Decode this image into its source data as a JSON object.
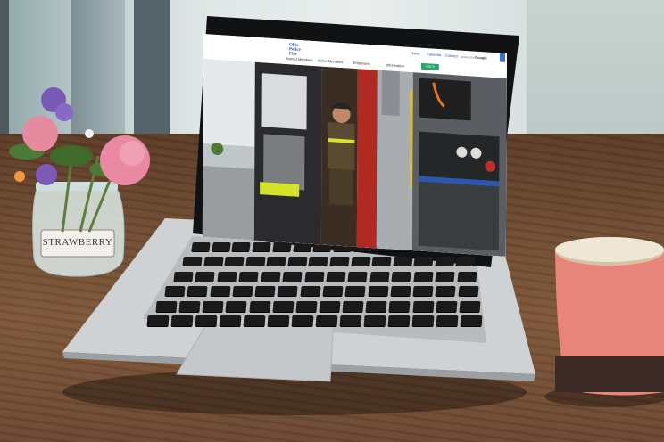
{
  "website": {
    "logo": {
      "line1": "Ohio",
      "line2": "Police",
      "line3": "Fire"
    },
    "top_links": [
      "Home",
      "Calendar",
      "Contact"
    ],
    "translate_label": "powered by",
    "translate_brand": "Google",
    "main_nav": [
      "Retired Members",
      "Active Members",
      "Employers",
      "Information"
    ],
    "login_label": "Log In",
    "accent_color": "#2aa66a"
  },
  "jar_label": "STRAWBERRY",
  "colors": {
    "brand_blue": "#2a4a9a",
    "fire_red": "#b02a22",
    "mug_pink": "#e8857a"
  }
}
